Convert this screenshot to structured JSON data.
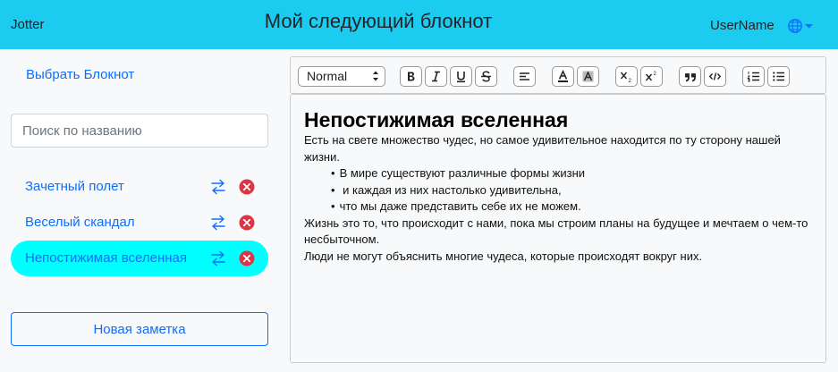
{
  "header": {
    "brand": "Jotter",
    "notebook_title": "Мой следующий блокнот",
    "username": "UserName",
    "language_icon": "globe-icon"
  },
  "sidebar": {
    "choose_notebook": "Выбрать Блокнот",
    "search_placeholder": "Поиск по названию",
    "notes": [
      {
        "title": "Зачетный полет",
        "active": false
      },
      {
        "title": "Веселый скандал",
        "active": false
      },
      {
        "title": "Непостижимая вселенная",
        "active": true
      }
    ],
    "new_note_label": "Новая заметка"
  },
  "toolbar": {
    "format_value": "Normal",
    "buttons": [
      "bold-icon",
      "italic-icon",
      "underline-icon",
      "strike-icon",
      "align-icon",
      "text-color-icon",
      "background-color-icon",
      "subscript-icon",
      "superscript-icon",
      "blockquote-icon",
      "code-block-icon",
      "ordered-list-icon",
      "bullet-list-icon"
    ]
  },
  "editor": {
    "title": "Непостижимая вселенная",
    "paragraph1": "Есть на свете множество чудес, но самое удивительное находится по ту сторону нашей жизни.",
    "bullets": [
      "В мире существуют различные формы жизни",
      " и каждая из них настолько удивительна,",
      "что мы даже представить себе их не можем."
    ],
    "paragraph2": "Жизнь это то, что происходит с нами, пока мы строим планы на будущее и мечтаем о чем-то несбыточном.",
    "paragraph3": "Люди не могут объяснить многие чудеса, которые происходят вокруг них."
  },
  "colors": {
    "header_bg": "#1ccbf0",
    "accent": "#0d6efd",
    "active_note_bg": "#00ffff",
    "delete_red": "#dc3545"
  }
}
